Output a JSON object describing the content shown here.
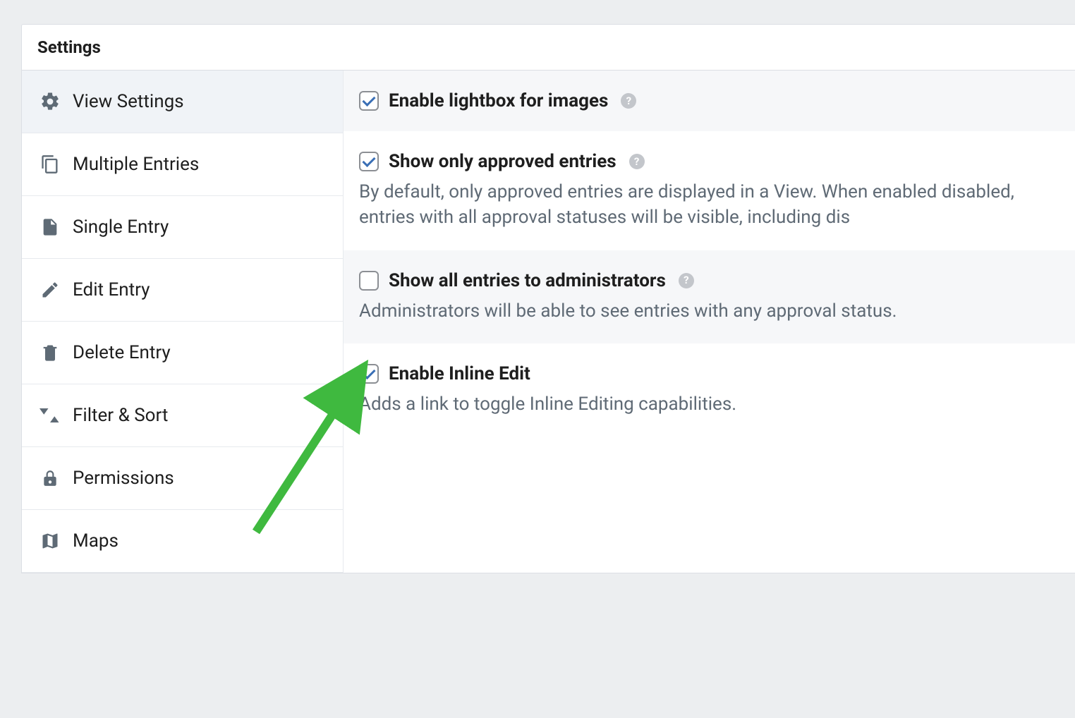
{
  "panel": {
    "title": "Settings"
  },
  "sidebar": {
    "items": [
      {
        "label": "View Settings",
        "icon": "gear",
        "active": true
      },
      {
        "label": "Multiple Entries",
        "icon": "copy",
        "active": false
      },
      {
        "label": "Single Entry",
        "icon": "file",
        "active": false
      },
      {
        "label": "Edit Entry",
        "icon": "pencil",
        "active": false
      },
      {
        "label": "Delete Entry",
        "icon": "trash",
        "active": false
      },
      {
        "label": "Filter & Sort",
        "icon": "sort",
        "active": false
      },
      {
        "label": "Permissions",
        "icon": "lock",
        "active": false
      },
      {
        "label": "Maps",
        "icon": "map",
        "active": false
      }
    ]
  },
  "settings": [
    {
      "label": "Enable lightbox for images",
      "checked": true,
      "help": true,
      "alt": true,
      "description": ""
    },
    {
      "label": "Show only approved entries",
      "checked": true,
      "help": true,
      "alt": false,
      "description": "By default, only approved entries are displayed in a View. When enabled disabled, entries with all approval statuses will be visible, including dis"
    },
    {
      "label": "Show all entries to administrators",
      "checked": false,
      "help": true,
      "alt": true,
      "description": "Administrators will be able to see entries with any approval status."
    },
    {
      "label": "Enable Inline Edit",
      "checked": true,
      "help": false,
      "alt": false,
      "description": "Adds a link to toggle Inline Editing capabilities."
    }
  ],
  "annotation": {
    "color": "#3fb93f"
  }
}
